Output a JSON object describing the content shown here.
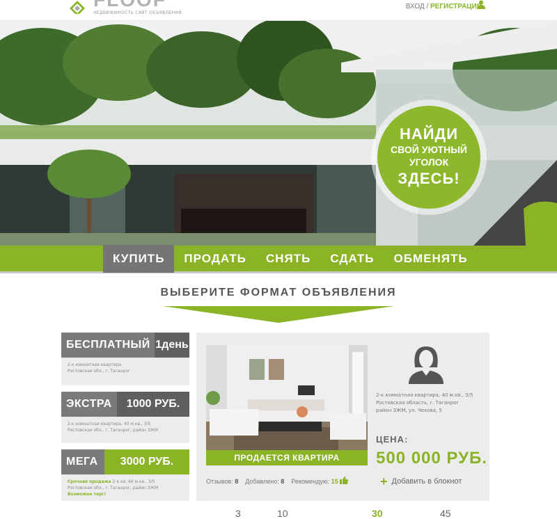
{
  "header": {
    "logo_text": "FLOOF",
    "tagline": "НЕДВИЖИМОСТЬ САЙТ ОБЪЯВЛЕНИЙ",
    "login": "ВХОД",
    "separator": "/",
    "register": "РЕГИСТРАЦИЯ"
  },
  "promo": {
    "line1": "НАЙДИ",
    "line2": "СВОЙ УЮТНЫЙ",
    "line3": "УГОЛОК",
    "line4": "ЗДЕСЬ!"
  },
  "nav": {
    "items": [
      {
        "label": "КУПИТЬ",
        "active": true
      },
      {
        "label": "ПРОДАТЬ",
        "active": false
      },
      {
        "label": "СНЯТЬ",
        "active": false
      },
      {
        "label": "СДАТЬ",
        "active": false
      },
      {
        "label": "ОБМЕНЯТЬ",
        "active": false
      }
    ]
  },
  "section_title": "ВЫБЕРИТЕ ФОРМАТ ОБЪЯВЛЕНИЯ",
  "plans": [
    {
      "name": "БЕСПЛАТНЫЙ",
      "price": "1день",
      "line1": "2-к комнатная квартира",
      "line2": "Ростовская обл., г. Таганрог"
    },
    {
      "name": "ЭКСТРА",
      "price": "1000 РУБ.",
      "line1": "2-к комнатная квартира, 40 м.кв., 3/5",
      "line2": "Ростовская обл., г. Таганрог, район ЗЖМ"
    },
    {
      "name": "МЕГА",
      "price": "3000 РУБ.",
      "highlight": "Срочная продажа",
      "line1": "2-к кв. 40 м.кв., 3/5",
      "line2": "Ростовская обл., г. Таганрог, район ЗЖМ",
      "line3": "Возможен торг!"
    }
  ],
  "card": {
    "photo_label": "ПРОДАЕТСЯ КВАРТИРА",
    "address_line1": "2-к комнатная квартира, 40 м.кв., 3/5",
    "address_line2": "Ростовская область, г. Таганрог",
    "address_line3": "район ЗЖМ, ул. Чехова, 5",
    "price_label": "ЦЕНА:",
    "price_value": "500 000 РУБ.",
    "reviews_label": "Отзывов:",
    "reviews_count": "8",
    "added_label": "Добавлено:",
    "added_count": "8",
    "recommend_label": "Рекомендую:",
    "recommend_count": "15",
    "notebook_label": "Добавить в блокнот"
  },
  "bottom_numbers": [
    "3",
    "10",
    "30",
    "45"
  ],
  "colors": {
    "accent": "#8ab325",
    "nav_active": "#757575",
    "plan_head": "#7a7a7a",
    "panel_bg": "#ececec"
  }
}
